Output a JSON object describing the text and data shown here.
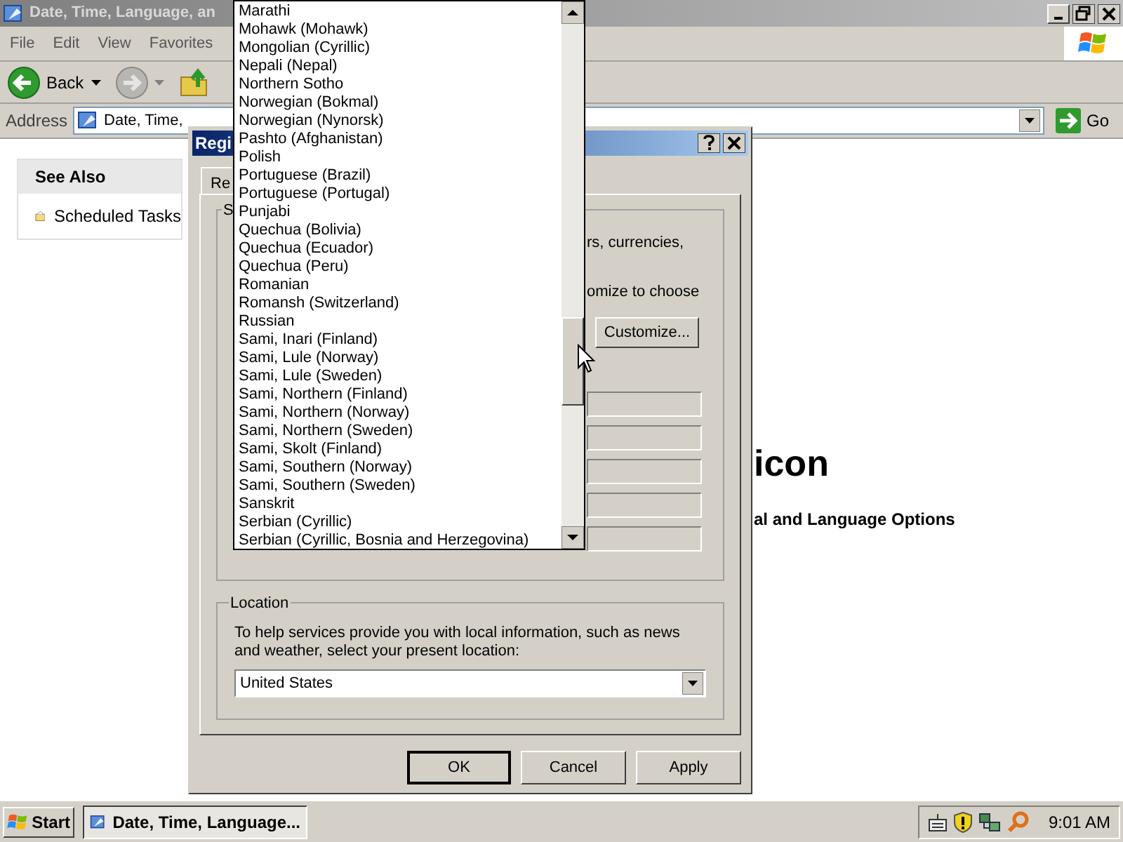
{
  "explorer": {
    "title": "Date, Time, Language, an",
    "menu": [
      "File",
      "Edit",
      "View",
      "Favorites"
    ],
    "back_button": "Back",
    "address_label": "Address",
    "address": "Date, Time,",
    "go_button": "Go",
    "see_also": {
      "title": "See Also",
      "items": [
        "Scheduled Tasks"
      ]
    },
    "heading": "icon",
    "subheading": "al and Language Options"
  },
  "dialog": {
    "title": "Regi",
    "tabs": [
      {
        "label": "Re",
        "selected": true
      }
    ],
    "standards": {
      "label": "S",
      "text_lines": [
        "rs, currencies,",
        "omize to choose"
      ],
      "customize_button": "Customize..."
    },
    "location": {
      "label": "Location",
      "text": "To help services provide you with local information, such as news and weather, select your present location:",
      "value": "United States"
    },
    "buttons": [
      {
        "label": "OK",
        "default": true
      },
      {
        "label": "Cancel",
        "default": false
      },
      {
        "label": "Apply",
        "default": false
      }
    ]
  },
  "language_list": {
    "items": [
      "Marathi",
      "Mohawk (Mohawk)",
      "Mongolian (Cyrillic)",
      "Nepali (Nepal)",
      "Northern Sotho",
      "Norwegian (Bokmal)",
      "Norwegian (Nynorsk)",
      "Pashto (Afghanistan)",
      "Polish",
      "Portuguese (Brazil)",
      "Portuguese (Portugal)",
      "Punjabi",
      "Quechua (Bolivia)",
      "Quechua (Ecuador)",
      "Quechua (Peru)",
      "Romanian",
      "Romansh (Switzerland)",
      "Russian",
      "Sami, Inari (Finland)",
      "Sami, Lule (Norway)",
      "Sami, Lule (Sweden)",
      "Sami, Northern (Finland)",
      "Sami, Northern (Norway)",
      "Sami, Northern (Sweden)",
      "Sami, Skolt (Finland)",
      "Sami, Southern (Norway)",
      "Sami, Southern (Sweden)",
      "Sanskrit",
      "Serbian (Cyrillic)",
      "Serbian (Cyrillic, Bosnia and Herzegovina)"
    ]
  },
  "taskbar": {
    "start_button": "Start",
    "tasks": [
      "Date, Time, Language..."
    ],
    "clock": "9:01 AM"
  }
}
